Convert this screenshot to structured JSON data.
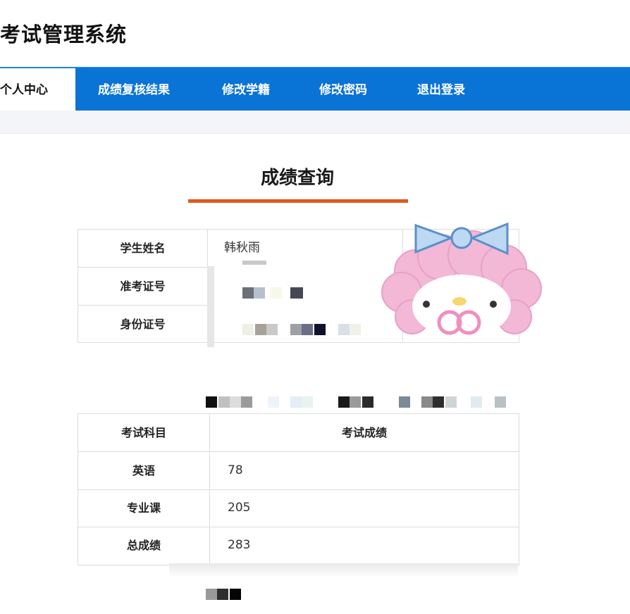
{
  "app": {
    "title": "考试管理系统"
  },
  "nav": {
    "items": [
      {
        "label": "个人中心",
        "active": true
      },
      {
        "label": "成绩复核结果"
      },
      {
        "label": "修改学籍"
      },
      {
        "label": "修改密码"
      },
      {
        "label": "退出登录"
      }
    ]
  },
  "page": {
    "title": "成绩查询"
  },
  "info": {
    "rows": [
      {
        "label": "学生姓名",
        "value": "韩秋雨"
      },
      {
        "label": "准考证号",
        "value": ""
      },
      {
        "label": "身份证号",
        "value": ""
      }
    ]
  },
  "scores": {
    "headers": {
      "subject": "考试科目",
      "score": "考试成绩"
    },
    "rows": [
      {
        "subject": "英语",
        "score": "78"
      },
      {
        "subject": "专业课",
        "score": "205"
      },
      {
        "subject": "总成绩",
        "score": "283"
      }
    ]
  },
  "colors": {
    "nav_bg": "#0a73d6",
    "accent_underline": "#e05a1e"
  }
}
